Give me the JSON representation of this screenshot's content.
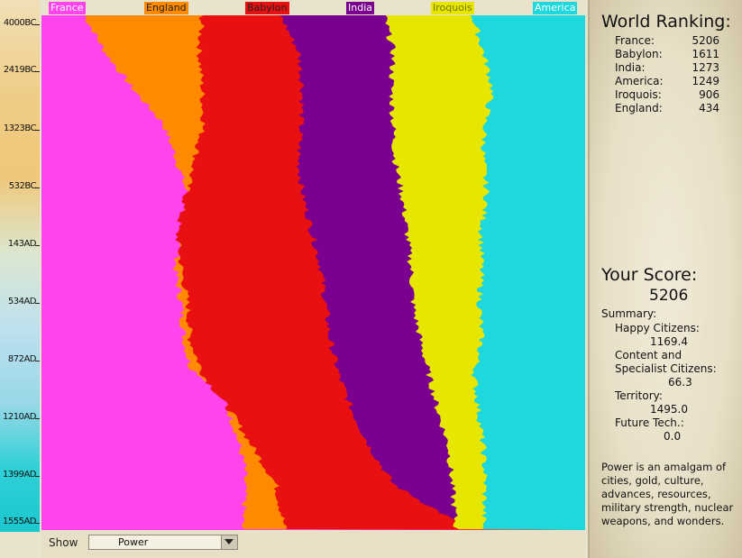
{
  "timeline": {
    "ticks": [
      "4000BC",
      "2419BC",
      "1323BC",
      "532BC",
      "143AD",
      "534AD",
      "872AD",
      "1210AD",
      "1399AD",
      "1555AD"
    ]
  },
  "civilizations": [
    {
      "name": "France",
      "color": "#ff44ee",
      "label_text_color": "#ffffff"
    },
    {
      "name": "England",
      "color": "#ff8a00",
      "label_text_color": "#222222"
    },
    {
      "name": "Babylon",
      "color": "#e81010",
      "label_text_color": "#222222"
    },
    {
      "name": "India",
      "color": "#7a0090",
      "label_text_color": "#ffffff"
    },
    {
      "name": "Iroquois",
      "color": "#e6e600",
      "label_text_color": "#777700"
    },
    {
      "name": "America",
      "color": "#1dd8dc",
      "label_text_color": "#ffffff"
    }
  ],
  "controls": {
    "show_label": "Show",
    "show_value": "Power"
  },
  "panel": {
    "ranking_title": "World Ranking:",
    "rankings": [
      {
        "name": "France:",
        "value": "5206"
      },
      {
        "name": "Babylon:",
        "value": "1611"
      },
      {
        "name": "India:",
        "value": "1273"
      },
      {
        "name": "America:",
        "value": "1249"
      },
      {
        "name": "Iroquois:",
        "value": "906"
      },
      {
        "name": "England:",
        "value": "434"
      }
    ],
    "score_title": "Your Score:",
    "score_value": "5206",
    "summary_title": "Summary:",
    "happy_label": "Happy Citizens:",
    "happy_value": "1169.4",
    "content_label_1": "Content and",
    "content_label_2": "Specialist Citizens:",
    "content_value": "66.3",
    "territory_label": "Territory:",
    "territory_value": "1495.0",
    "future_label": "Future Tech.:",
    "future_value": "0.0",
    "description": "Power is an amalgam of cities, gold, culture, advances, resources, military strength, nuclear weapons, and wonders."
  }
}
